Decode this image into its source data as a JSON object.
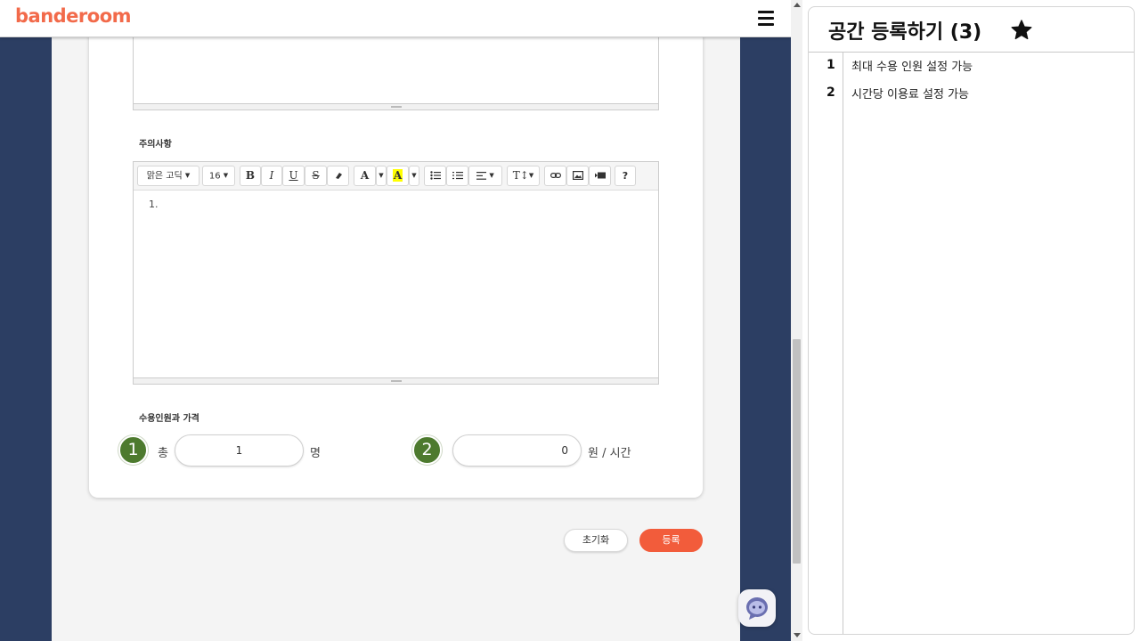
{
  "header": {
    "logo": "banderoom"
  },
  "editor": {
    "caution_label": "주의사항",
    "font_family": "맑은 고딕",
    "font_size": "16",
    "help": "?",
    "list_start": "1."
  },
  "capacity": {
    "label": "수용인원과 가격",
    "badge_1": "1",
    "badge_2": "2",
    "prefix": "총",
    "count_value": "1",
    "count_unit": "명",
    "price_value": "0",
    "price_unit": "원 / 시간"
  },
  "actions": {
    "reset": "초기화",
    "submit": "등록"
  },
  "panel": {
    "title": "공간 등록하기 (3)",
    "notes": [
      {
        "num": "1",
        "text": "최대 수용 인원 설정 가능"
      },
      {
        "num": "2",
        "text": "시간당 이용료 설정 가능"
      }
    ]
  },
  "colors": {
    "brand": "#f26a4a",
    "badge": "#4d7a2e",
    "submit": "#f25c3b",
    "sidebar_bg": "#2c3e63"
  }
}
